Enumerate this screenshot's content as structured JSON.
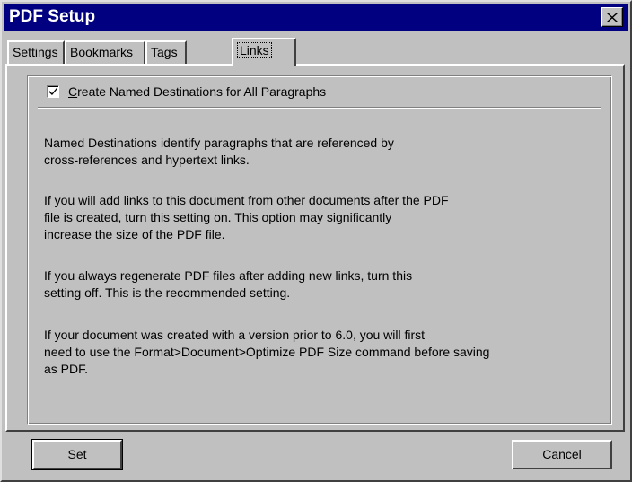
{
  "window": {
    "title": "PDF Setup",
    "close_icon": "close-x-icon"
  },
  "tabs": [
    {
      "label": "Settings",
      "active": false
    },
    {
      "label": "Bookmarks",
      "active": false
    },
    {
      "label": "Tags",
      "active": false
    },
    {
      "label": "Links",
      "active": true
    }
  ],
  "links_tab": {
    "checkbox": {
      "checked": true,
      "mnemonic": "C",
      "label_rest": "reate Named Destinations for All Paragraphs"
    },
    "paragraphs": [
      "Named Destinations identify paragraphs that are referenced by\ncross-references and hypertext links.",
      "If you will add links to this document from other documents after the PDF\nfile is created, turn this setting on.  This option may significantly\nincrease the size of the PDF file.",
      "If you always regenerate PDF files after adding new links, turn this\nsetting off.  This is the recommended setting.",
      "If your document was created with a version prior to 6.0, you will first\nneed to use the Format>Document>Optimize PDF Size command before saving\nas PDF."
    ]
  },
  "buttons": {
    "set_mnemonic": "S",
    "set_rest": "et",
    "cancel": "Cancel"
  }
}
